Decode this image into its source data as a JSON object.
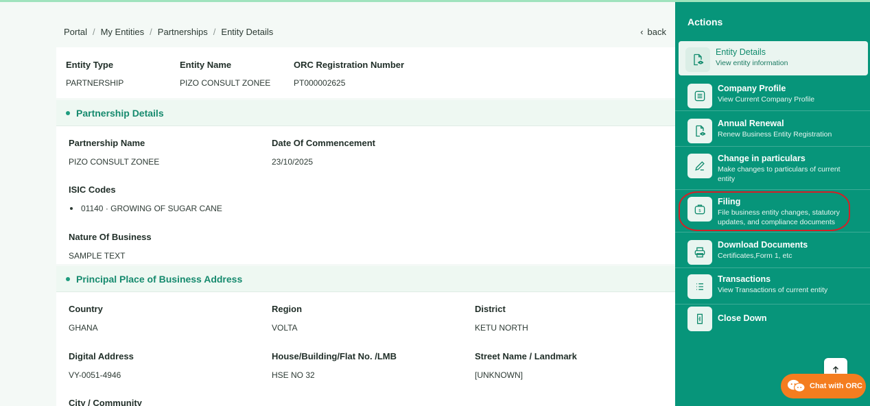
{
  "breadcrumb": [
    "Portal",
    "My Entities",
    "Partnerships",
    "Entity Details"
  ],
  "back_label": "back",
  "summary": [
    {
      "label": "Entity Type",
      "value": "PARTNERSHIP"
    },
    {
      "label": "Entity Name",
      "value": "PIZO CONSULT ZONEE"
    },
    {
      "label": "ORC Registration Number",
      "value": "PT000002625"
    }
  ],
  "partnership": {
    "title": "Partnership Details",
    "name_label": "Partnership Name",
    "name_value": "PIZO CONSULT ZONEE",
    "date_label": "Date Of Commencement",
    "date_value": "23/10/2025",
    "isic_label": "ISIC Codes",
    "isic_codes": [
      "01140 · GROWING OF SUGAR CANE"
    ],
    "nature_label": "Nature Of Business",
    "nature_value": "SAMPLE TEXT"
  },
  "address": {
    "title": "Principal Place of Business Address",
    "country_label": "Country",
    "country_value": "GHANA",
    "region_label": "Region",
    "region_value": "VOLTA",
    "district_label": "District",
    "district_value": "KETU NORTH",
    "digital_label": "Digital Address",
    "digital_value": "VY-0051-4946",
    "house_label": "House/Building/Flat No. /LMB",
    "house_value": "HSE NO 32",
    "street_label": "Street Name / Landmark",
    "street_value": "[UNKNOWN]",
    "city_label": "City / Community"
  },
  "sidebar": {
    "title": "Actions",
    "items": [
      {
        "title": "Entity Details",
        "desc": "View entity information",
        "icon": "file-eye-icon"
      },
      {
        "title": "Company Profile",
        "desc": "View Current Company Profile",
        "icon": "list-icon"
      },
      {
        "title": "Annual Renewal",
        "desc": "Renew Business Entity Registration",
        "icon": "file-eye-icon"
      },
      {
        "title": "Change in particulars",
        "desc": "Make changes to particulars of current entity",
        "icon": "pencil-icon"
      },
      {
        "title": "Filing",
        "desc": "File business entity changes, statutory updates, and compliance documents",
        "icon": "briefcase-icon"
      },
      {
        "title": "Download Documents",
        "desc": "Certificates,Form 1, etc",
        "icon": "printer-icon"
      },
      {
        "title": "Transactions",
        "desc": "View Transactions of current entity",
        "icon": "list-bullets-icon"
      },
      {
        "title": "Close Down",
        "desc": "",
        "icon": "door-icon"
      }
    ]
  },
  "chat_label": "Chat with ORC",
  "colors": {
    "sidebar": "#07957a",
    "accent": "#168a6e",
    "chat": "#f47d1f",
    "highlight": "#d41f26"
  }
}
